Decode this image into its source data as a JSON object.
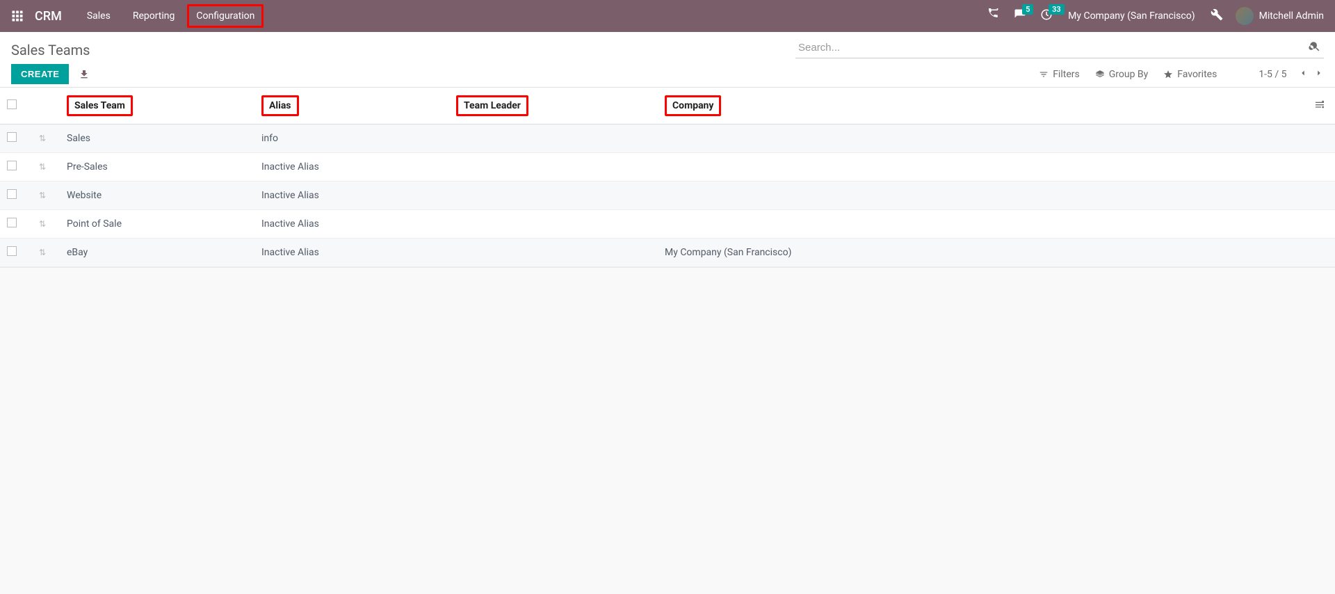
{
  "navbar": {
    "brand": "CRM",
    "menu": {
      "sales": "Sales",
      "reporting": "Reporting",
      "configuration": "Configuration"
    },
    "messages_badge": "5",
    "activities_badge": "33",
    "company": "My Company (San Francisco)",
    "user": "Mitchell Admin"
  },
  "control": {
    "breadcrumb": "Sales Teams",
    "search_placeholder": "Search...",
    "create": "CREATE",
    "filters": "Filters",
    "group_by": "Group By",
    "favorites": "Favorites",
    "pager": "1-5 / 5"
  },
  "table": {
    "columns": {
      "sales_team": "Sales Team",
      "alias": "Alias",
      "team_leader": "Team Leader",
      "company": "Company"
    },
    "rows": [
      {
        "sales_team": "Sales",
        "alias": "info",
        "team_leader": "",
        "company": ""
      },
      {
        "sales_team": "Pre-Sales",
        "alias": "Inactive Alias",
        "team_leader": "",
        "company": ""
      },
      {
        "sales_team": "Website",
        "alias": "Inactive Alias",
        "team_leader": "",
        "company": ""
      },
      {
        "sales_team": "Point of Sale",
        "alias": "Inactive Alias",
        "team_leader": "",
        "company": ""
      },
      {
        "sales_team": "eBay",
        "alias": "Inactive Alias",
        "team_leader": "",
        "company": "My Company (San Francisco)"
      }
    ]
  }
}
